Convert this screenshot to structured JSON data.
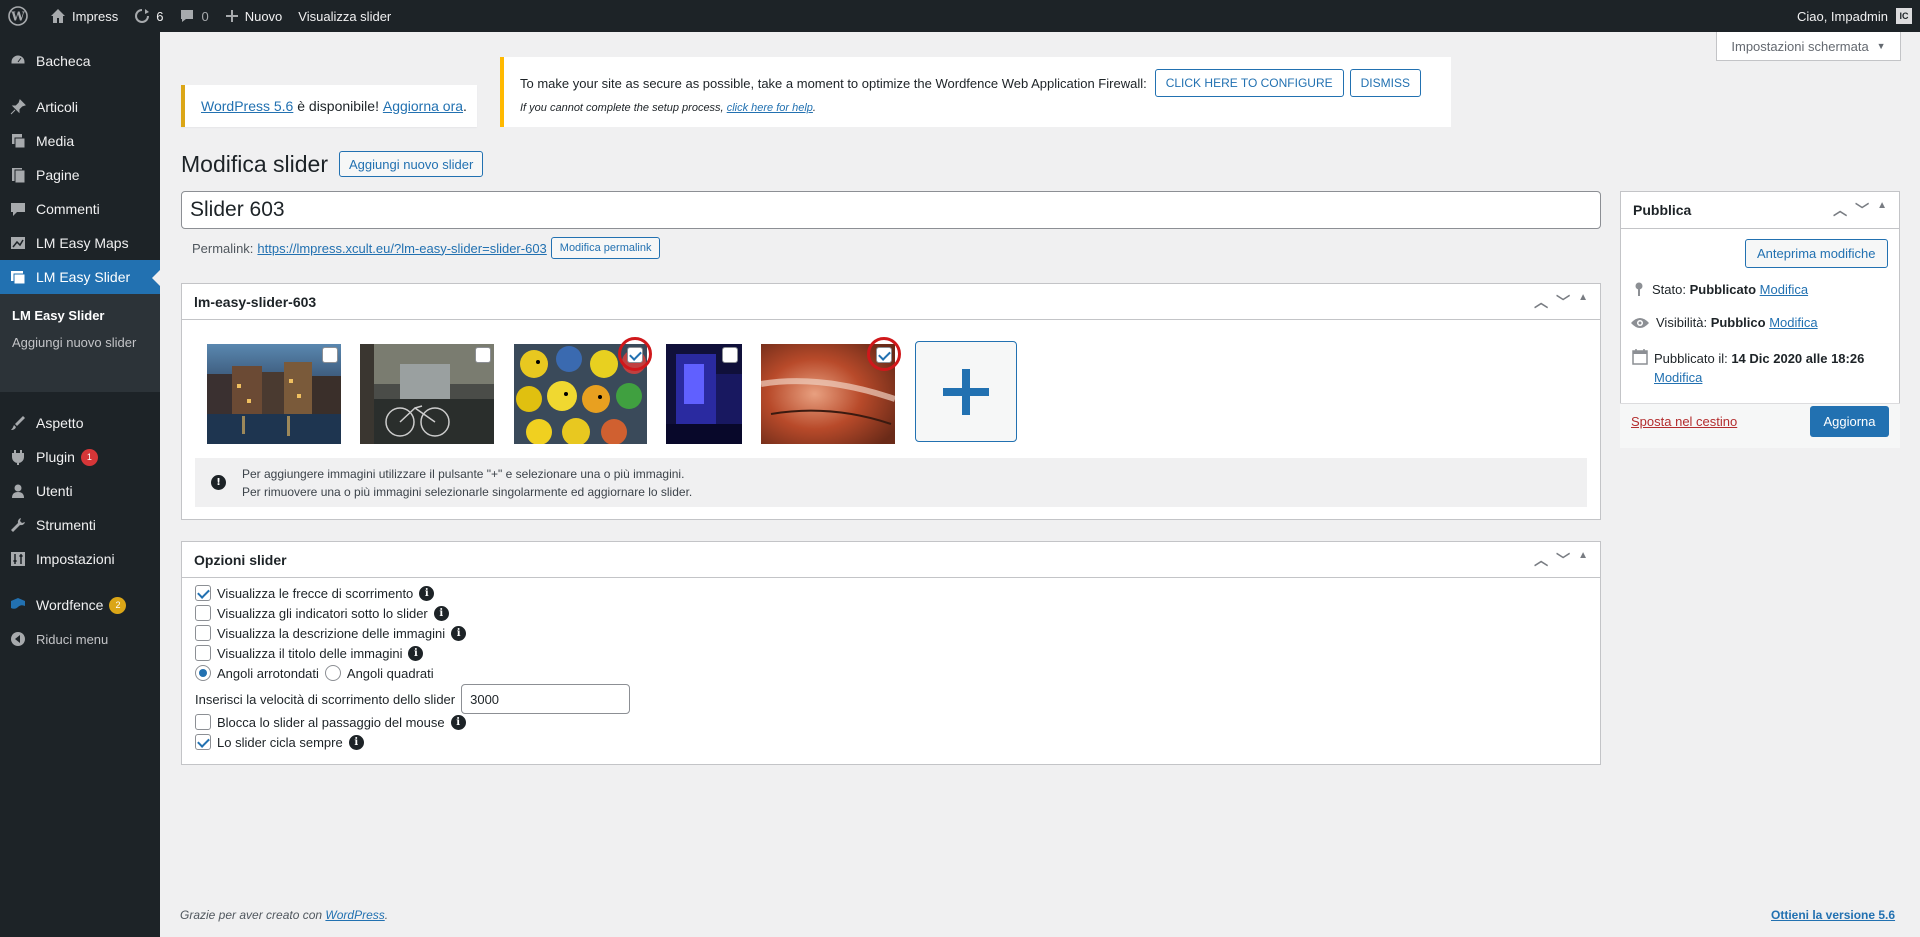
{
  "admin_bar": {
    "site": "Impress",
    "updates": "6",
    "comments": "0",
    "new": "Nuovo",
    "view": "Visualizza slider",
    "greeting": "Ciao, Impadmin",
    "avatar": "IC"
  },
  "menu": {
    "items": [
      {
        "label": "Bacheca",
        "icon": "dashboard-icon"
      },
      {
        "label": "Articoli",
        "icon": "pin-icon"
      },
      {
        "label": "Media",
        "icon": "media-icon"
      },
      {
        "label": "Pagine",
        "icon": "page-icon"
      },
      {
        "label": "Commenti",
        "icon": "comment-icon"
      },
      {
        "label": "LM Easy Maps",
        "icon": "map-icon"
      },
      {
        "label": "LM Easy Slider",
        "icon": "images-icon"
      },
      {
        "label": "Aspetto",
        "icon": "brush-icon"
      },
      {
        "label": "Plugin",
        "icon": "plugin-icon",
        "badge": "1"
      },
      {
        "label": "Utenti",
        "icon": "user-icon"
      },
      {
        "label": "Strumenti",
        "icon": "wrench-icon"
      },
      {
        "label": "Impostazioni",
        "icon": "settings-icon"
      },
      {
        "label": "Wordfence",
        "icon": "wordfence-icon",
        "badge": "2"
      },
      {
        "label": "Riduci menu",
        "icon": "collapse-icon"
      }
    ],
    "submenu": [
      "LM Easy Slider",
      "Aggiungi nuovo slider"
    ]
  },
  "screen_options": "Impostazioni schermata",
  "update_notice": {
    "link": "WordPress 5.6",
    "text": " è disponibile! ",
    "action": "Aggiorna ora",
    "end": "."
  },
  "wordfence": {
    "text": "To make your site as secure as possible, take a moment to optimize the Wordfence Web Application Firewall:",
    "configure": "CLICK HERE TO CONFIGURE",
    "dismiss": "DISMISS",
    "help_text": "If you cannot complete the setup process, ",
    "help_link": "click here for help",
    "help_end": "."
  },
  "page": {
    "title": "Modifica slider",
    "add_new": "Aggiungi nuovo slider",
    "post_title": "Slider 603",
    "permalink_label": "Permalink:",
    "permalink_url": "https://lmpress.xcult.eu/?lm-easy-slider=slider-603",
    "edit_permalink": "Modifica permalink"
  },
  "images_box": {
    "title": "lm-easy-slider-603",
    "info1": "Per aggiungere immagini utilizzare il pulsante \"+\" e selezionare una o più immagini.",
    "info2": "Per rimuovere una o più immagini selezionarle singolarmente ed aggiornare lo slider."
  },
  "images": [
    {
      "name": "canal-night",
      "checked": false
    },
    {
      "name": "bicycles-canal",
      "checked": false
    },
    {
      "name": "rubber-ducks",
      "checked": true
    },
    {
      "name": "blue-room",
      "checked": false
    },
    {
      "name": "red-close-up",
      "checked": true
    }
  ],
  "options": {
    "title": "Opzioni slider",
    "arrows": "Visualizza le frecce di scorrimento",
    "indicators": "Visualizza gli indicatori sotto lo slider",
    "description": "Visualizza la descrizione delle immagini",
    "img_title": "Visualizza il titolo delle immagini",
    "rounded": "Angoli arrotondati",
    "square": "Angoli quadrati",
    "speed_label": "Inserisci la velocità di scorrimento dello slider",
    "speed": "3000",
    "hover": "Blocca lo slider al passaggio del mouse",
    "loop": "Lo slider cicla sempre"
  },
  "publish": {
    "title": "Pubblica",
    "preview": "Anteprima modifiche",
    "status_label": "Stato: ",
    "status": "Pubblicato",
    "visibility_label": "Visibilità: ",
    "visibility": "Pubblico",
    "published_label": "Pubblicato il: ",
    "published": "14 Dic 2020 alle 18:26",
    "edit": "Modifica",
    "trash": "Sposta nel cestino",
    "update": "Aggiorna"
  },
  "footer": {
    "text": "Grazie per aver creato con ",
    "link": "WordPress",
    "end": ".",
    "version": "Ottieni la versione 5.6"
  },
  "colors": {
    "accent": "#2271b1",
    "dark": "#1d2327",
    "warning": "#dba617",
    "danger": "#d63638"
  }
}
